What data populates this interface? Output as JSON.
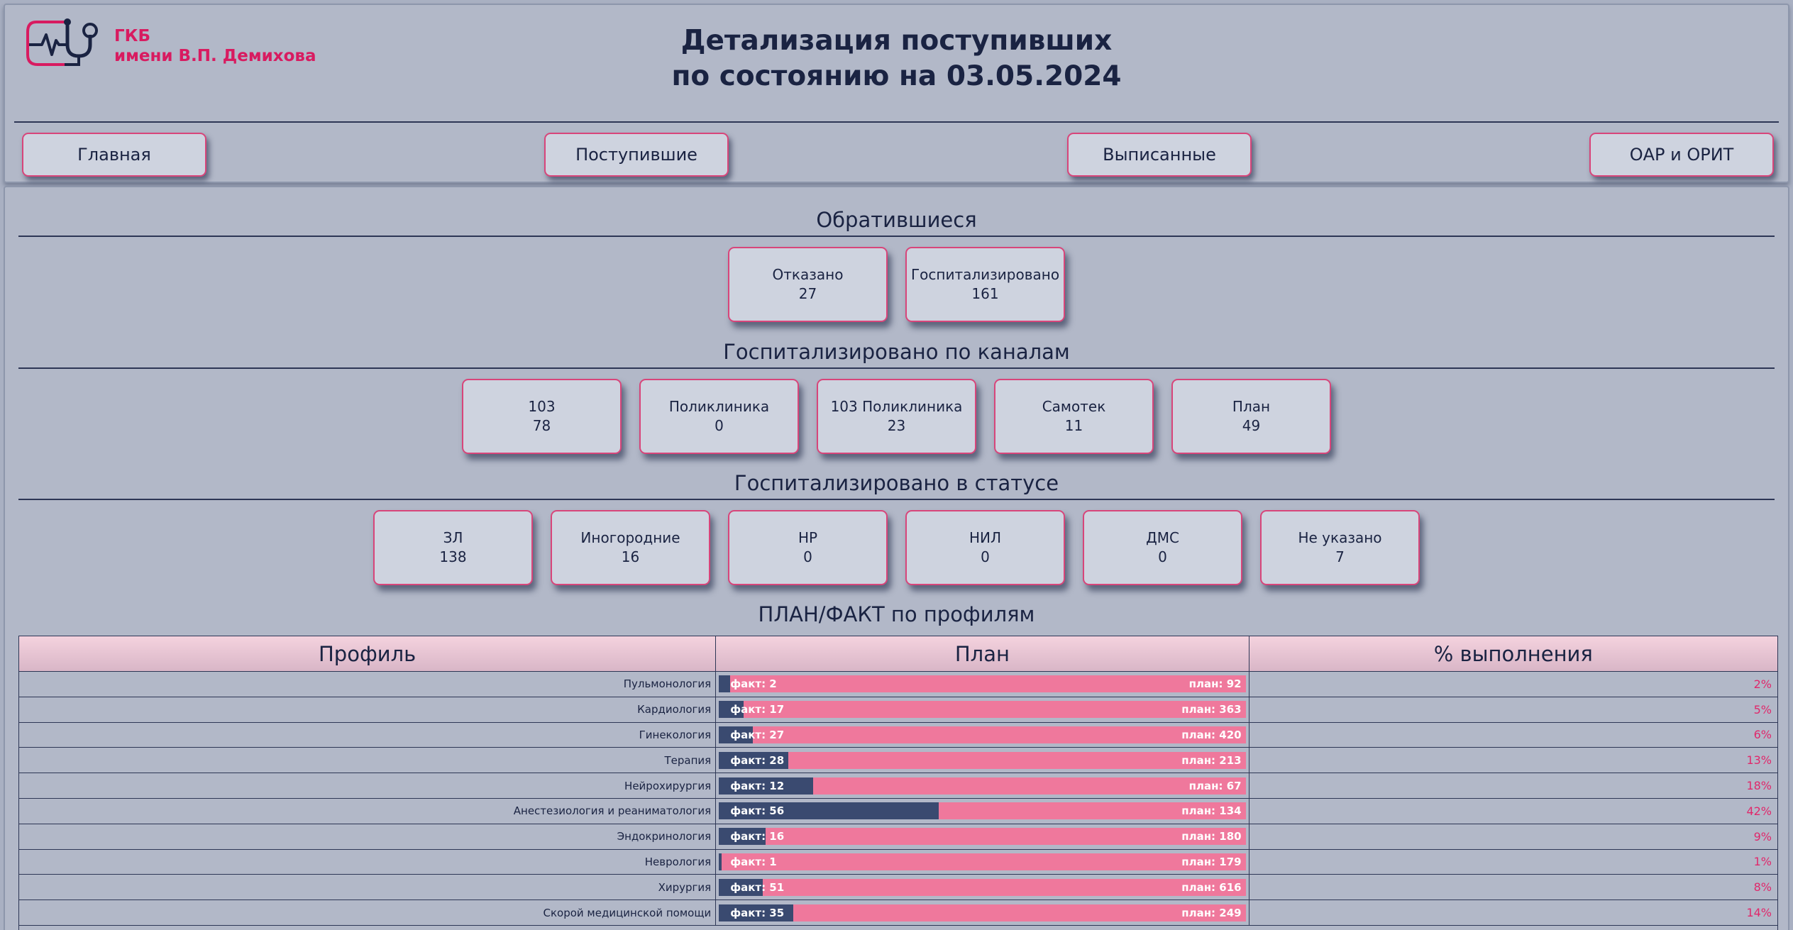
{
  "header": {
    "hospital_line1": "ГКБ",
    "hospital_line2": "имени В.П. Демихова",
    "title_line1": "Детализация поступивших",
    "title_line2": "по состоянию на 03.05.2024"
  },
  "nav": [
    {
      "label": "Главная"
    },
    {
      "label": "Поступившие"
    },
    {
      "label": "Выписанные"
    },
    {
      "label": "ОАР и ОРИТ"
    }
  ],
  "applied": {
    "title": "Обратившиеся",
    "cards": [
      {
        "label": "Отказано",
        "value": "27"
      },
      {
        "label": "Госпитализировано",
        "value": "161"
      }
    ]
  },
  "channels": {
    "title": "Госпитализировано по каналам",
    "cards": [
      {
        "label": "103",
        "value": "78"
      },
      {
        "label": "Поликлиника",
        "value": "0"
      },
      {
        "label": "103 Поликлиника",
        "value": "23"
      },
      {
        "label": "Самотек",
        "value": "11"
      },
      {
        "label": "План",
        "value": "49"
      }
    ]
  },
  "status": {
    "title": "Госпитализировано в статусе",
    "cards": [
      {
        "label": "ЗЛ",
        "value": "138"
      },
      {
        "label": "Иногородние",
        "value": "16"
      },
      {
        "label": "НР",
        "value": "0"
      },
      {
        "label": "НИЛ",
        "value": "0"
      },
      {
        "label": "ДМС",
        "value": "0"
      },
      {
        "label": "Не указано",
        "value": "7"
      }
    ]
  },
  "planfact": {
    "title": "ПЛАН/ФАКТ по профилям",
    "columns": [
      "Профиль",
      "План",
      "% выполнения"
    ],
    "rows": [
      {
        "profile": "Пульмонология",
        "fact": 2,
        "plan": 92,
        "fact_label": "факт: 2",
        "plan_label": "план: 92",
        "pct": "2%"
      },
      {
        "profile": "Кардиология",
        "fact": 17,
        "plan": 363,
        "fact_label": "факт: 17",
        "plan_label": "план: 363",
        "pct": "5%"
      },
      {
        "profile": "Гинекология",
        "fact": 27,
        "plan": 420,
        "fact_label": "факт: 27",
        "plan_label": "план: 420",
        "pct": "6%"
      },
      {
        "profile": "Терапия",
        "fact": 28,
        "plan": 213,
        "fact_label": "факт: 28",
        "plan_label": "план: 213",
        "pct": "13%"
      },
      {
        "profile": "Нейрохирургия",
        "fact": 12,
        "plan": 67,
        "fact_label": "факт: 12",
        "plan_label": "план: 67",
        "pct": "18%"
      },
      {
        "profile": "Анестезиология и реаниматология",
        "fact": 56,
        "plan": 134,
        "fact_label": "факт: 56",
        "plan_label": "план: 134",
        "pct": "42%"
      },
      {
        "profile": "Эндокринология",
        "fact": 16,
        "plan": 180,
        "fact_label": "факт: 16",
        "plan_label": "план: 180",
        "pct": "9%"
      },
      {
        "profile": "Неврология",
        "fact": 1,
        "plan": 179,
        "fact_label": "факт: 1",
        "plan_label": "план: 179",
        "pct": "1%"
      },
      {
        "profile": "Хирургия",
        "fact": 51,
        "plan": 616,
        "fact_label": "факт: 51",
        "plan_label": "план: 616",
        "pct": "8%"
      },
      {
        "profile": "Скорой медицинской помощи",
        "fact": 35,
        "plan": 249,
        "fact_label": "факт: 35",
        "plan_label": "план: 249",
        "pct": "14%"
      }
    ]
  },
  "colors": {
    "accent": "#d81b60",
    "bar_plan": "#ef789c",
    "bar_fact": "#3a4a70"
  }
}
